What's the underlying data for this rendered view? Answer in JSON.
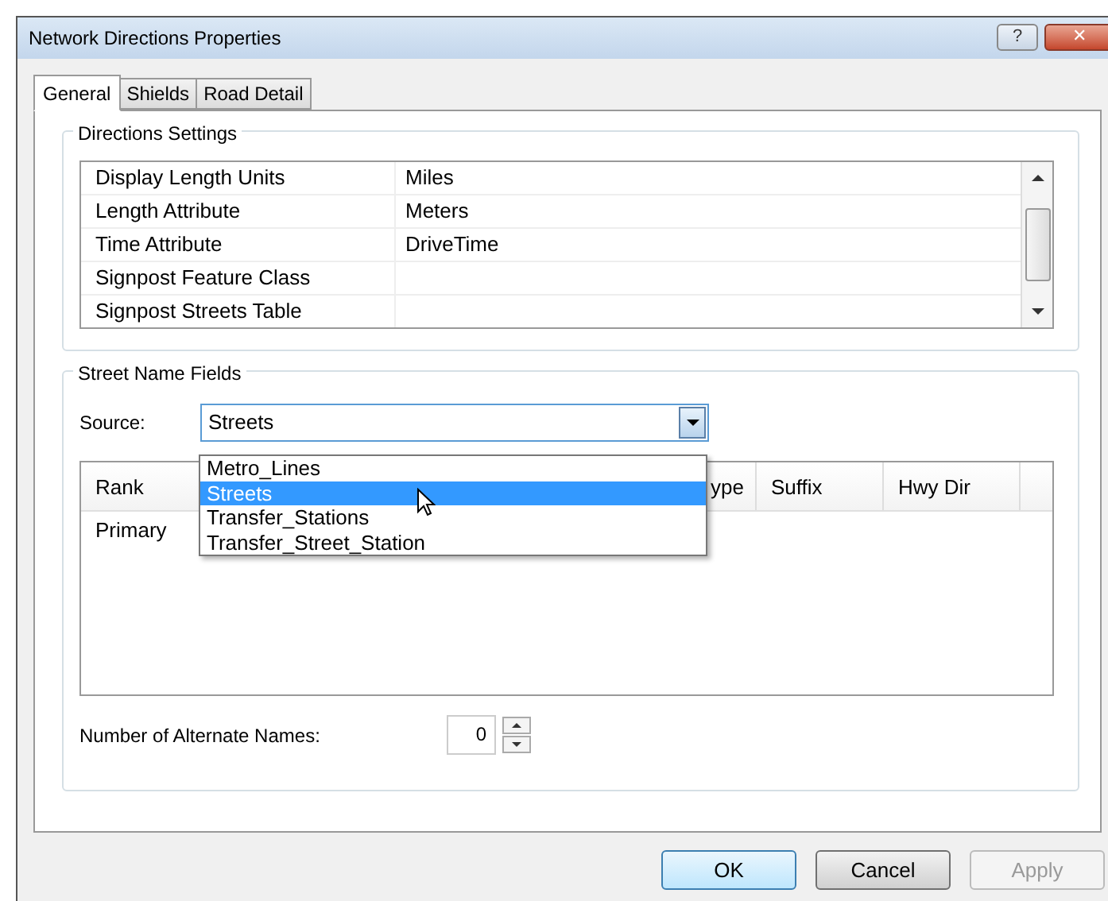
{
  "window": {
    "title": "Network Directions Properties",
    "help": "?",
    "close": "✕"
  },
  "tabs": [
    {
      "label": "General",
      "selected": true
    },
    {
      "label": "Shields",
      "selected": false
    },
    {
      "label": "Road Detail",
      "selected": false
    }
  ],
  "directions_settings": {
    "title": "Directions Settings",
    "rows": [
      {
        "name": "Display Length Units",
        "value": "Miles"
      },
      {
        "name": "Length Attribute",
        "value": "Meters"
      },
      {
        "name": "Time Attribute",
        "value": "DriveTime"
      },
      {
        "name": "Signpost Feature Class",
        "value": ""
      },
      {
        "name": "Signpost Streets Table",
        "value": ""
      }
    ]
  },
  "street_name_fields": {
    "title": "Street Name Fields",
    "source_label": "Source:",
    "source_value": "Streets",
    "options": [
      {
        "label": "Metro_Lines",
        "selected": false
      },
      {
        "label": "Streets",
        "selected": true
      },
      {
        "label": "Transfer_Stations",
        "selected": false
      },
      {
        "label": "Transfer_Street_Station",
        "selected": false
      }
    ],
    "columns": [
      "Rank",
      "ype",
      "Suffix",
      "Hwy Dir"
    ],
    "rows": [
      [
        "Primary"
      ]
    ],
    "alternate_label": "Number of Alternate Names:",
    "alternate_value": "0"
  },
  "buttons": [
    {
      "label": "OK",
      "disabled": false,
      "default": true
    },
    {
      "label": "Cancel",
      "disabled": false,
      "default": false
    },
    {
      "label": "Apply",
      "disabled": true,
      "default": false
    }
  ]
}
